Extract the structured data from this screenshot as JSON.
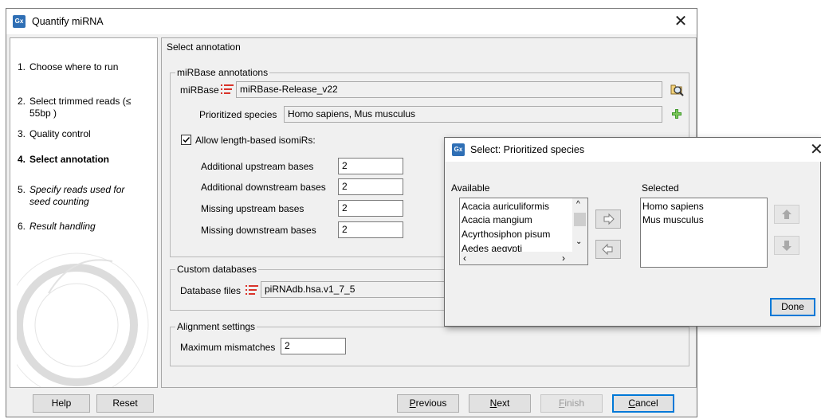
{
  "main_window": {
    "title": "Quantify miRNA",
    "logo_text": "Gx"
  },
  "steps": [
    {
      "num": "1.",
      "label": "Choose where to run",
      "style": "normal"
    },
    {
      "num": "2.",
      "label": "Select trimmed reads (≤ 55bp )",
      "style": "normal"
    },
    {
      "num": "3.",
      "label": "Quality control",
      "style": "normal"
    },
    {
      "num": "4.",
      "label": "Select annotation",
      "style": "bold"
    },
    {
      "num": "5.",
      "label": "Specify reads used for seed counting",
      "style": "italic"
    },
    {
      "num": "6.",
      "label": "Result handling",
      "style": "italic"
    }
  ],
  "content": {
    "section_title": "Select annotation",
    "mirbase_group": {
      "legend": "miRBase annotations",
      "mirbase_label": "miRBase",
      "mirbase_value": "miRBase-Release_v22",
      "species_label": "Prioritized species",
      "species_value": "Homo sapiens, Mus musculus",
      "isomirs_label": "Allow length-based isomiRs:",
      "isomirs_checked": true,
      "fields": [
        {
          "label": "Additional upstream bases",
          "value": "2"
        },
        {
          "label": "Additional downstream bases",
          "value": "2"
        },
        {
          "label": "Missing upstream bases",
          "value": "2"
        },
        {
          "label": "Missing downstream bases",
          "value": "2"
        }
      ]
    },
    "custom_group": {
      "legend": "Custom databases",
      "db_label": "Database files",
      "db_value": "piRNAdb.hsa.v1_7_5"
    },
    "alignment_group": {
      "legend": "Alignment settings",
      "mismatch_label": "Maximum mismatches",
      "mismatch_value": "2"
    }
  },
  "buttons": {
    "help": "Help",
    "reset": "Reset",
    "previous_prefix": "P",
    "previous_rest": "revious",
    "next_prefix": "N",
    "next_rest": "ext",
    "finish_prefix": "F",
    "finish_rest": "inish",
    "cancel_prefix": "C",
    "cancel_rest": "ancel"
  },
  "select_dialog": {
    "title": "Select: Prioritized species",
    "logo_text": "Gx",
    "available_label": "Available",
    "selected_label": "Selected",
    "available_items": [
      "Acacia auriculiformis",
      "Acacia mangium",
      "Acyrthosiphon pisum",
      "Aedes aegypti"
    ],
    "selected_items": [
      "Homo sapiens",
      "Mus musculus"
    ],
    "done_label": "Done"
  },
  "colors": {
    "accent": "#0078d7",
    "list_icon_red": "#d9342b",
    "add_icon_green": "#3f9a2b",
    "logo_blue": "#2f6fb5"
  }
}
